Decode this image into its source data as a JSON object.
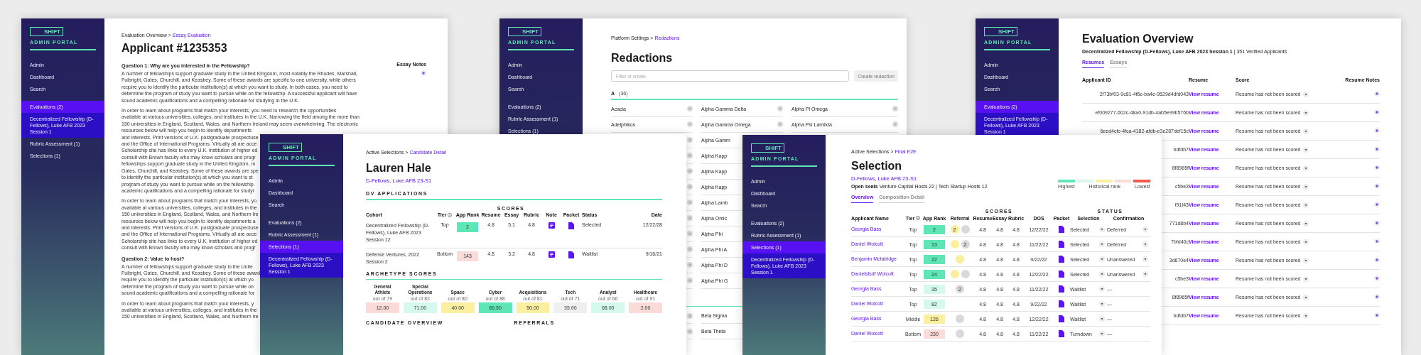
{
  "applicant_window": {
    "sidebar": {
      "logo": "SHIFT",
      "subtitle": "ADMIN PORTAL",
      "groups": [
        {
          "items": [
            {
              "label": "Admin",
              "selected": false,
              "kind": "nav"
            },
            {
              "label": "Dashboard",
              "selected": false,
              "kind": "nav"
            },
            {
              "label": "Search",
              "selected": false,
              "kind": "nav"
            }
          ]
        },
        {
          "items": [
            {
              "label": "Evaluations (2)",
              "selected": true,
              "kind": "nav"
            },
            {
              "label": "Decentralized Fellowship (D-Fellows), Luke AFB 2023 Session 1",
              "selected": false,
              "kind": "sub"
            },
            {
              "label": "Rubric Assessment (1)",
              "selected": false,
              "kind": "nav"
            },
            {
              "label": "Selections (1)",
              "selected": false,
              "kind": "nav"
            }
          ]
        }
      ]
    },
    "breadcrumb": {
      "items": [
        "Evaluation Overview",
        "Essay Evaluation"
      ],
      "separator": ">"
    },
    "title": "Applicant #1235353",
    "notes_heading": "Essay Notes",
    "questions": [
      {
        "heading": "Question 1: Why are you interested in the Fellowship?",
        "paragraphs": [
          [
            "A number of fellowships support graduate study in the United Kingdom, most notably the Rhodes, Marshall,",
            "Fulbright, Gates, Churchill, and Keasbey. Some of these awards are specific to one university, while others",
            "require you to identify the particular institution(s) at which you want to study. In both cases, you need to",
            "determine the program of study you want to pursue while on the fellowship. A successful applicant will have",
            "sound academic qualifications and a compelling rationale for studying in the U.K."
          ],
          [
            "In order to learn about programs that match your interests, you need to research the opportunities",
            "available at various universities, colleges, and institutes in the U.K. Narrowing the field among the more than",
            "150 universities in England, Scotland, Wales, and Northern Ireland may seem overwhelming. The electronic",
            "resources below will help you begin to identify departments",
            "and interests. Print versions of U.K. postgraduate prospectuse",
            "and the Office of International Programs. Virtually all are acce",
            "Scholarship site has links to every U.K. institution of higher ed",
            "consult with Brown faculty who may know scholars and progr",
            "fellowships support graduate study in the United Kingdom, m",
            "Gates, Churchill, and Keasbey. Some of these awards are spe",
            "to identify the particular institution(s) at which you want to st",
            "program of study you want to pursue while on the fellowship.",
            "academic qualifications and a compelling rationale for studyi"
          ],
          [
            "In order to learn about programs that match your interests, yo",
            "available at various universities, colleges, and institutes in the",
            "150 universities in England, Scotland, Wales, and Northern Ire",
            "resources below will help you begin to identify departments a",
            "and interests. Print versions of U.K. postgraduate prospectuse",
            "and the Office of International Programs. Virtually all are acce",
            "Scholarship site has links to every U.K. institution of higher ed",
            "consult with Brown faculty who may know scholars and progr"
          ]
        ]
      },
      {
        "heading": "Question 2: Value to host?",
        "paragraphs": [
          [
            "A number of fellowships support graduate study in the Unite",
            "Fulbright, Gates, Churchill, and Keasbey. Some of these award",
            "require you to identify the particular institution(s) at which yo",
            "determine the program of study you want to pursue while on",
            "sound academic qualifications and a compelling rationale for"
          ],
          [
            "In order to learn about programs that match your interests, y",
            "available at various universities, colleges, and institutes in the",
            "150 universities in England, Scotland, Wales, and Northern Ire"
          ]
        ]
      }
    ]
  },
  "redactions_window": {
    "sidebar": {
      "logo": "SHIFT",
      "subtitle": "ADMIN PORTAL",
      "groups": [
        {
          "items": [
            {
              "label": "Admin",
              "selected": false,
              "kind": "nav"
            },
            {
              "label": "Dashboard",
              "selected": false,
              "kind": "nav"
            },
            {
              "label": "Search",
              "selected": false,
              "kind": "nav"
            }
          ]
        },
        {
          "items": [
            {
              "label": "Evaluations (2)",
              "selected": false,
              "kind": "nav"
            },
            {
              "label": "Rubric Assessment (1)",
              "selected": false,
              "kind": "nav"
            },
            {
              "label": "Selections (1)",
              "selected": false,
              "kind": "nav"
            }
          ]
        }
      ]
    },
    "breadcrumb": {
      "items": [
        "Platform Settings",
        "Redactions"
      ],
      "separator": ">"
    },
    "title": "Redactions",
    "search": {
      "placeholder": "Filter or create"
    },
    "create_button": {
      "label": "Create redaction",
      "disabled": true
    },
    "sections": [
      {
        "letter": "A",
        "count": "(36)",
        "columns": [
          [
            "Acacia",
            "Adelphikos"
          ],
          [
            "Alpha Gamma Delta",
            "Alpha Gamma Omega",
            "Alpha Gamm",
            "Alpha Kapp",
            "Alpha Kapp",
            "Alpha Kapp",
            "Alpha Lamb",
            "Alpha Omic",
            "Alpha Phi",
            "Alpha Phi A",
            "Alpha Phi D",
            "Alpha Phi G"
          ],
          [
            "Alpha Pi Omega",
            "Alpha Psi Lambda"
          ]
        ]
      },
      {
        "columns": [
          [],
          [
            "Beta Sigma",
            "Beta Theta"
          ],
          []
        ]
      }
    ]
  },
  "evaluation_window": {
    "sidebar": {
      "logo": "SHIFT",
      "subtitle": "ADMIN PORTAL",
      "groups": [
        {
          "items": [
            {
              "label": "Admin",
              "selected": false,
              "kind": "nav"
            },
            {
              "label": "Dashboard",
              "selected": false,
              "kind": "nav"
            },
            {
              "label": "Search",
              "selected": false,
              "kind": "nav"
            }
          ]
        },
        {
          "items": [
            {
              "label": "Evaluations (2)",
              "selected": true,
              "kind": "nav"
            },
            {
              "label": "Decentralized Fellowship (D-Fellows), Luke AFB 2023 Session 1",
              "selected": false,
              "kind": "sub"
            }
          ]
        }
      ]
    },
    "title": "Evaluation Overview",
    "subtitle": "**Decentralized Fellowship (D-Fellows), Luke AFB 2023 Session 1**  |  351 Verified Applicants",
    "tabs": [
      {
        "label": "Resumes",
        "selected": true
      },
      {
        "label": "Essays",
        "selected": false
      }
    ],
    "columns": [
      "Applicant ID",
      "Resume",
      "Score",
      "Resume Notes"
    ],
    "rows": [
      {
        "id": "2f73bf03-9c81-4f6c-ba4e-9529d4dfd043",
        "link": "View resume",
        "score": "Resume has not been scored"
      },
      {
        "id": "ef009277-602c-48a0-91db-4ab5e99b576b",
        "link": "View resume",
        "score": "Resume has not been scored"
      },
      {
        "id": "6eed4cfc-4fca-4182-afdb-e3e287def15c",
        "link": "View resume",
        "score": "Resume has not been scored"
      },
      {
        "id": "bdfdb7",
        "link": "View resume",
        "score": "Resume has not been scored"
      },
      {
        "id": "8f8965f",
        "link": "View resume",
        "score": "Resume has not been scored"
      },
      {
        "id": "c5be3",
        "link": "View resume",
        "score": "Resume has not been scored"
      },
      {
        "id": "f91f43",
        "link": "View resume",
        "score": "Resume has not been scored"
      },
      {
        "id": "771d8b4",
        "link": "View resume",
        "score": "Resume has not been scored"
      },
      {
        "id": "7bfd40c",
        "link": "View resume",
        "score": "Resume has not been scored"
      },
      {
        "id": "3d670e4",
        "link": "View resume",
        "score": "Resume has not been scored"
      },
      {
        "id": "c5be3",
        "link": "View resume",
        "score": "Resume has not been scored"
      },
      {
        "id": "8f8965f",
        "link": "View resume",
        "score": "Resume has not been scored"
      },
      {
        "id": "bdfdb7",
        "link": "View resume",
        "score": "Resume has not been scored"
      }
    ]
  },
  "candidate_window": {
    "sidebar": {
      "logo": "SHIFT",
      "subtitle": "ADMIN PORTAL",
      "groups": [
        {
          "items": [
            {
              "label": "Admin",
              "selected": false,
              "kind": "nav"
            },
            {
              "label": "Dashboard",
              "selected": false,
              "kind": "nav"
            },
            {
              "label": "Search",
              "selected": false,
              "kind": "nav"
            }
          ]
        },
        {
          "items": [
            {
              "label": "Evaluations (2)",
              "selected": false,
              "kind": "nav"
            },
            {
              "label": "Rubric Assessment (1)",
              "selected": false,
              "kind": "nav"
            },
            {
              "label": "Selections (1)",
              "selected": true,
              "kind": "nav"
            },
            {
              "label": "Decentralized Fellowship (D-Fellows), Luke AFB 2023 Session 1",
              "selected": false,
              "kind": "sub"
            }
          ]
        }
      ]
    },
    "breadcrumb": {
      "items": [
        "Active Selections",
        "Candidate Detail"
      ],
      "separator": ">"
    },
    "title": "Lauren Hale",
    "subtitle": "D-Fellows, Luke AFB 23-S1",
    "applications_heading": "DV APPLICATIONS",
    "scores_heading": "SCORES",
    "columns": [
      "Cohort",
      "Tier",
      "App Rank",
      "Resume",
      "Essay",
      "Rubric",
      "Note",
      "Packet",
      "Status",
      "Date"
    ],
    "rows": [
      {
        "cohort": "Decentralized Fellowship (D-Fellows), Luke AFB 2023 Session 12",
        "tier": "Top",
        "rank": {
          "value": "2",
          "color": "#5ee6b5"
        },
        "resume": "4.8",
        "essay": "5.1",
        "rubric": "4.8",
        "status": "Selected",
        "date": "12/22/28"
      },
      {
        "cohort": "Defense Ventures, 2022 Session 2",
        "tier": "Bottom",
        "rank": {
          "value": "143",
          "color": "#fadbd8"
        },
        "resume": "4.8",
        "essay": "3.2",
        "rubric": "4.8",
        "status": "Waitlist",
        "date": "9/16/21"
      }
    ],
    "archetype_heading": "ARCHETYPE SCORES",
    "archetypes": [
      {
        "name": "General Athlete",
        "out_of": "out of 79",
        "value": "12.00",
        "color": "#fadbd8"
      },
      {
        "name": "Special Operations",
        "out_of": "out of 82",
        "value": "71.00",
        "color": "#d5f9ec"
      },
      {
        "name": "Space",
        "out_of": "out of 80",
        "value": "40.00",
        "color": "#fcf0a0"
      },
      {
        "name": "Cyber",
        "out_of": "out of 88",
        "value": "86.50",
        "color": "#5ee6b5"
      },
      {
        "name": "Acquisitions",
        "out_of": "out of 81",
        "value": "50.00",
        "color": "#fcf0a0"
      },
      {
        "name": "Tech",
        "out_of": "out of 71",
        "value": "35.00",
        "color": "#efefef"
      },
      {
        "name": "Analyst",
        "out_of": "out of 66",
        "value": "68.00",
        "color": "#d5f9ec"
      },
      {
        "name": "Healthcare",
        "out_of": "out of 91",
        "value": "2.00",
        "color": "#fadbd8"
      }
    ],
    "overview_heading": "CANDIDATE OVERVIEW",
    "referrals_heading": "REFERRALS"
  },
  "selection_window": {
    "sidebar": {
      "logo": "SHIFT",
      "subtitle": "ADMIN PORTAL",
      "groups": [
        {
          "items": [
            {
              "label": "Admin",
              "selected": false,
              "kind": "nav"
            },
            {
              "label": "Dashboard",
              "selected": false,
              "kind": "nav"
            },
            {
              "label": "Search",
              "selected": false,
              "kind": "nav"
            }
          ]
        },
        {
          "items": [
            {
              "label": "Evaluations (2)",
              "selected": false,
              "kind": "nav"
            },
            {
              "label": "Rubric Assessment (1)",
              "selected": false,
              "kind": "nav"
            },
            {
              "label": "Selections (1)",
              "selected": true,
              "kind": "nav"
            },
            {
              "label": "Decentralized Fellowship (D-Fellows), Luke AFB 2023 Session 1",
              "selected": false,
              "kind": "sub"
            }
          ]
        }
      ]
    },
    "breadcrumb": {
      "items": [
        "Active Selections",
        "Final E2E"
      ],
      "separator": ">"
    },
    "title": "Selection",
    "subtitle": "D-Fellows, Luke AFB 23-S1",
    "open_seats": "**Open seats**  Venture Capital Hosts 22  |  Tech Startup Hosts 12",
    "legend": {
      "colors": [
        {
          "color": "#5ee6b5"
        },
        {
          "color": "#d5f9ec"
        },
        {
          "color": "#fcf0a0"
        },
        {
          "color": "#fadbd8"
        },
        {
          "color": "#f5574a"
        }
      ],
      "labels": [
        "Highest",
        "Historical rank",
        "Lowest"
      ]
    },
    "tabs": [
      {
        "label": "Overview",
        "selected": true
      },
      {
        "label": "Composition Detail",
        "selected": false
      }
    ],
    "scores_heading": "SCORES",
    "status_heading": "STATUS",
    "columns": [
      "Applicant Name",
      "Tier",
      "App Rank",
      "Referral",
      "Resume",
      "Essay",
      "Rubric",
      "DOS",
      "Packet",
      "Selection",
      "Confirmation"
    ],
    "rows": [
      {
        "name": "Georgia Bass",
        "tier": "Top",
        "rank": {
          "value": "2",
          "color": "#5ee6b5"
        },
        "referrals": [
          {
            "color": "#fbee9c",
            "count": "2"
          },
          {
            "color": "#d9d9d9"
          }
        ],
        "resume": "4.8",
        "essay": "4.8",
        "rubric": "4.8",
        "dos": "12/22/22",
        "selection": "Selected",
        "confirmation": "Deferred",
        "confirmation_dropdown": true
      },
      {
        "name": "Daniel Wolcott",
        "tier": "Top",
        "rank": {
          "value": "13",
          "color": "#5ee6b5"
        },
        "referrals": [
          {
            "color": "#fbee9c"
          },
          {
            "color": "#d9d9d9",
            "count": "2"
          }
        ],
        "resume": "4.8",
        "essay": "4.8",
        "rubric": "4.8",
        "dos": "11/22/22",
        "selection": "Selected",
        "confirmation": "Deferred",
        "confirmation_dropdown": true
      },
      {
        "name": "Benjamin Mcfatridge",
        "tier": "Top",
        "rank": {
          "value": "22",
          "color": "#5ee6b5"
        },
        "referrals": [
          {
            "color": "#fbee9c"
          }
        ],
        "resume": "4.8",
        "essay": "4.8",
        "rubric": "4.8",
        "dos": "9/22/22",
        "selection": "Selected",
        "confirmation": "Unanswered",
        "confirmation_dropdown": true
      },
      {
        "name": "Danielsfsdf Wolcott",
        "tier": "Top",
        "rank": {
          "value": "24",
          "color": "#5ee6b5"
        },
        "referrals": [
          {
            "color": "#fbee9c"
          },
          {
            "color": "#d9d9d9"
          }
        ],
        "resume": "4.8",
        "essay": "4.8",
        "rubric": "4.8",
        "dos": "12/22/22",
        "selection": "Selected",
        "confirmation": "Unanswered",
        "confirmation_dropdown": true
      },
      {
        "name": "Georgia Bass",
        "tier": "Top",
        "rank": {
          "value": "35",
          "color": "#d5f9ec"
        },
        "referrals": [
          {
            "color": "#d9d9d9",
            "count": "2"
          }
        ],
        "resume": "4.8",
        "essay": "4.8",
        "rubric": "4.8",
        "dos": "11/22/22",
        "selection": "Waitlist",
        "confirmation": "—",
        "confirmation_dropdown": false
      },
      {
        "name": "Daniel Wolcott",
        "tier": "Top",
        "rank": {
          "value": "82",
          "color": "#d5f9ec"
        },
        "referrals": [],
        "resume": "4.8",
        "essay": "4.8",
        "rubric": "4.8",
        "dos": "9/22/22",
        "selection": "Waitlist",
        "confirmation": "—",
        "confirmation_dropdown": false
      },
      {
        "name": "Georgia Bass",
        "tier": "Middle",
        "rank": {
          "value": "126",
          "color": "#fcf0a0"
        },
        "referrals": [
          {
            "color": "#d9d9d9"
          }
        ],
        "resume": "4.8",
        "essay": "4.8",
        "rubric": "4.8",
        "dos": "12/22/22",
        "selection": "Waitlist",
        "confirmation": "—",
        "confirmation_dropdown": false
      },
      {
        "name": "Daniel Wolcott",
        "tier": "Bottom",
        "rank": {
          "value": "230",
          "color": "#fadbd8"
        },
        "referrals": [
          {
            "color": "#d9d9d9"
          }
        ],
        "resume": "4.8",
        "essay": "4.8",
        "rubric": "4.8",
        "dos": "11/22/22",
        "selection": "Turndown",
        "confirmation": "—",
        "confirmation_dropdown": false
      }
    ]
  }
}
